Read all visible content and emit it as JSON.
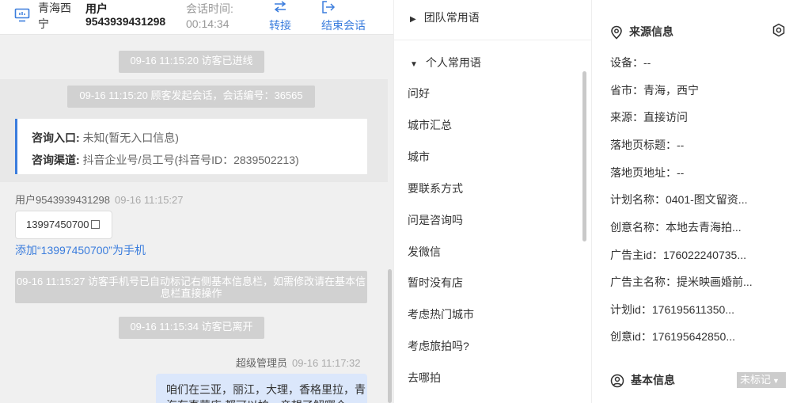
{
  "header": {
    "location": "青海西宁",
    "user": "用户9543939431298",
    "time_label": "会话时间:",
    "time_value": "00:14:34",
    "transfer_label": "转接",
    "end_label": "结束会话"
  },
  "chat": {
    "sys1": "09-16 11:15:20 访客已进线",
    "sys2": "09-16 11:15:20 顾客发起会话，会话编号：36565",
    "info_entry_label": "咨询入口:",
    "info_entry_value": "未知(暂无入口信息)",
    "info_channel_label": "咨询渠道:",
    "info_channel_value": "抖音企业号/员工号(抖音号ID：2839502213)",
    "visitor_name": "用户9543939431298",
    "visitor_time": "09-16 11:15:27",
    "phone": "13997450700",
    "add_phone_link": "添加“13997450700”为手机",
    "sys3": "09-16 11:15:27 访客手机号已自动标记右侧基本信息栏，如需修改请在基本信息栏直接操作",
    "sys4": "09-16 11:15:34 访客已离开",
    "agent_name": "超级管理员",
    "agent_time": "09-16 11:17:32",
    "agent_msg": "咱们在三亚，丽江，大理，香格里拉，青海有直营店 都可以拍，亲想了解哪个"
  },
  "phrases": {
    "team_group": "团队常用语",
    "personal_group": "个人常用语",
    "items": [
      "问好",
      "城市汇总",
      "城市",
      "要联系方式",
      "问是咨询吗",
      "发微信",
      "暂时没有店",
      "考虑热门城市",
      "考虑旅拍吗?",
      "去哪拍"
    ]
  },
  "source": {
    "title": "来源信息",
    "rows": [
      "设备：--",
      "省市：青海，西宁",
      "来源：直接访问",
      "落地页标题：--",
      "落地页地址：--",
      "计划名称：0401-图文留资...",
      "创意名称：本地去青海拍...",
      "广告主id：176022240735...",
      "广告主名称：提米映画婚前...",
      "计划id：176195611350...",
      "创意id：176195642850..."
    ],
    "basic_title": "基本信息",
    "tag_label": "未标记"
  },
  "icons": [
    "monitor-icon",
    "transfer-icon",
    "exit-icon",
    "location-pin-icon",
    "settings-icon",
    "user-circle-icon",
    "copy-icon"
  ],
  "colors": {
    "accent": "#3b7ddd",
    "system_pill": "#d1d1d1",
    "agent_bubble": "#dbe7fb",
    "chat_bg": "#f0f0f0"
  }
}
